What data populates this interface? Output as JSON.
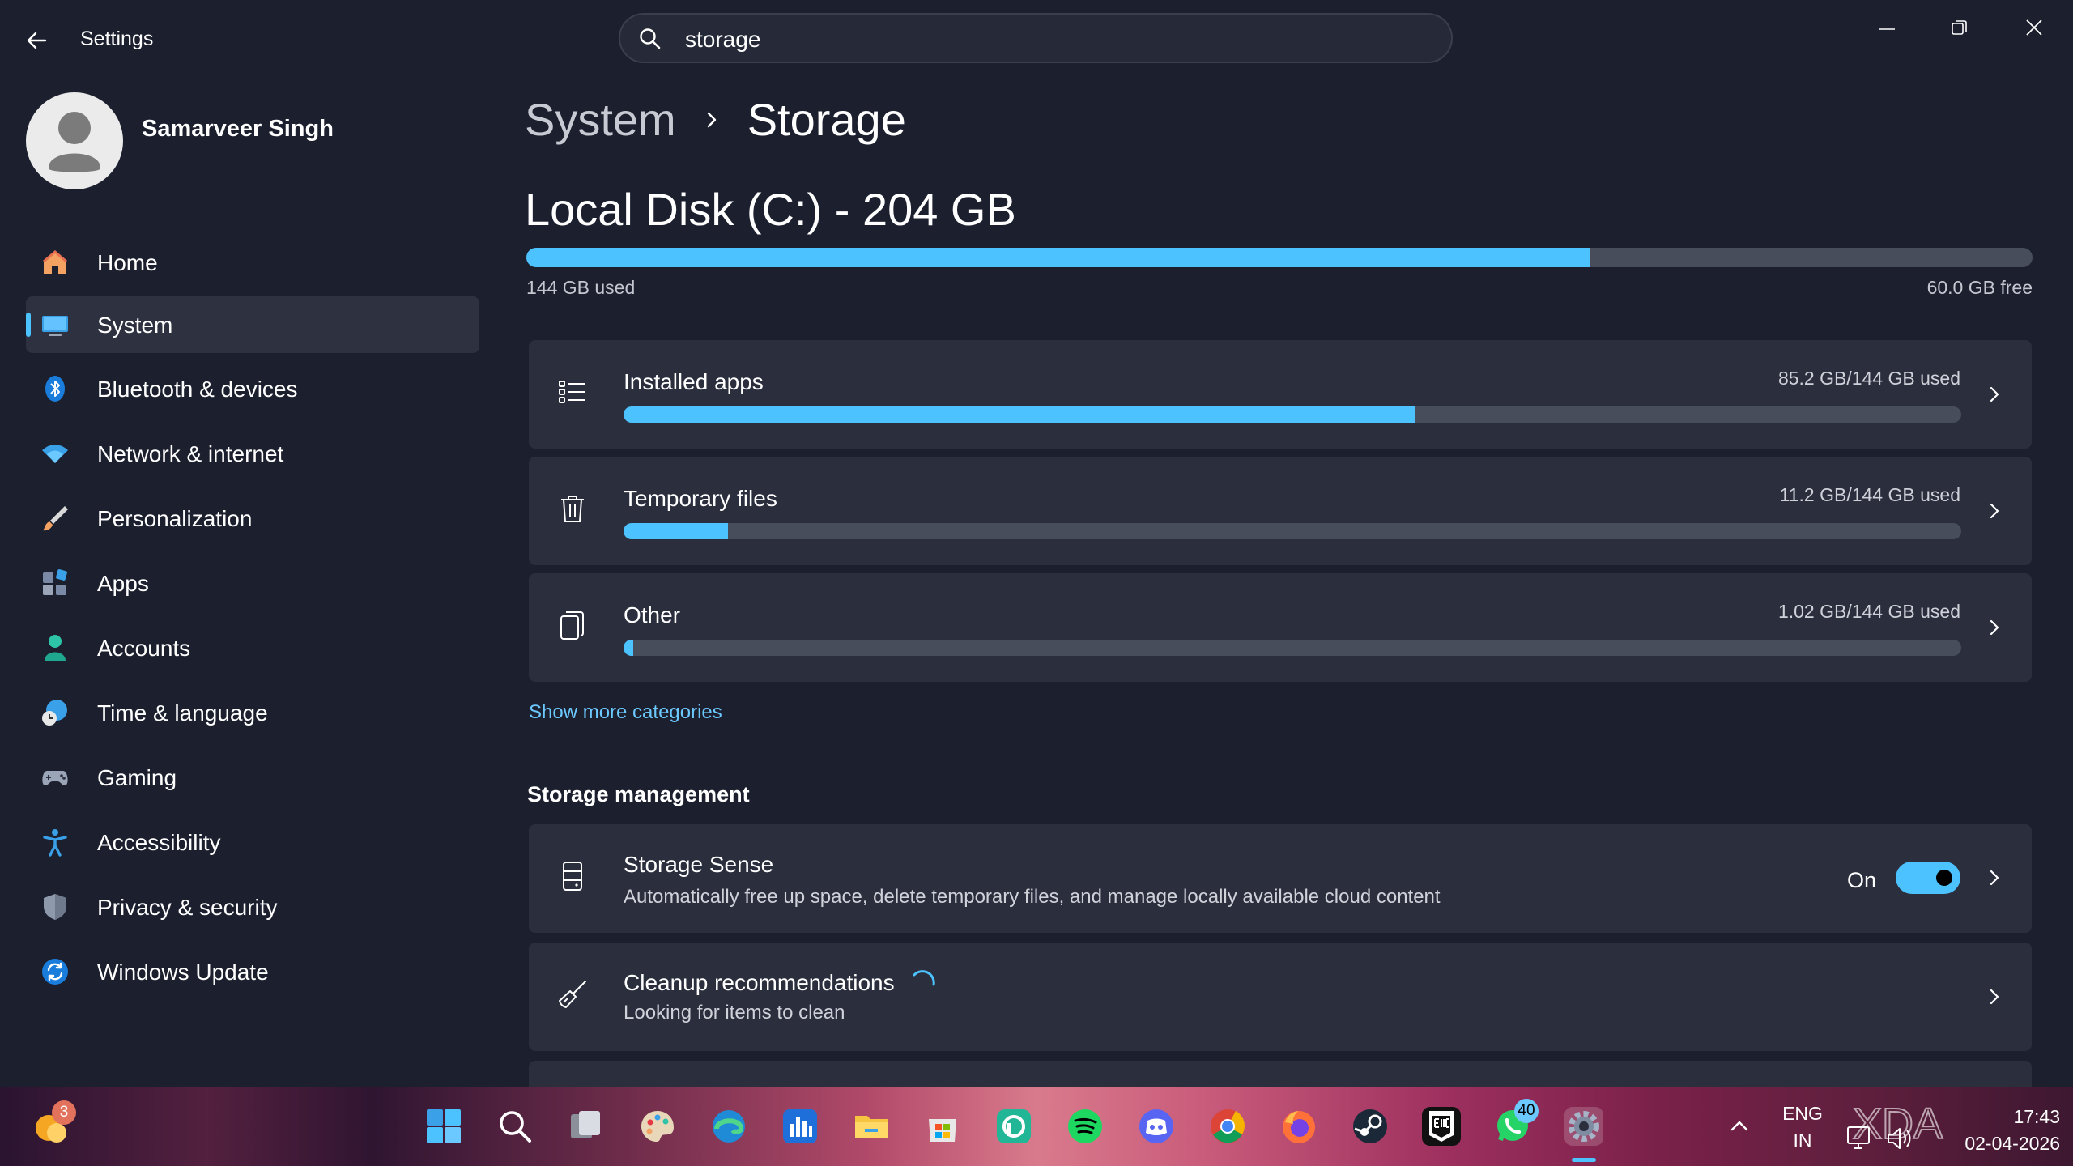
{
  "window": {
    "title": "Settings",
    "search_value": "storage",
    "controls": [
      "minimize-icon",
      "maximize-icon",
      "close-icon"
    ]
  },
  "user": {
    "name": "Samarveer Singh"
  },
  "sidebar": {
    "items": [
      {
        "label": "Home",
        "icon": "home-icon"
      },
      {
        "label": "System",
        "icon": "system-icon",
        "selected": true
      },
      {
        "label": "Bluetooth & devices",
        "icon": "bluetooth-icon"
      },
      {
        "label": "Network & internet",
        "icon": "wifi-icon"
      },
      {
        "label": "Personalization",
        "icon": "brush-icon"
      },
      {
        "label": "Apps",
        "icon": "apps-icon"
      },
      {
        "label": "Accounts",
        "icon": "account-icon"
      },
      {
        "label": "Time & language",
        "icon": "globe-clock-icon"
      },
      {
        "label": "Gaming",
        "icon": "gamepad-icon"
      },
      {
        "label": "Accessibility",
        "icon": "accessibility-icon"
      },
      {
        "label": "Privacy & security",
        "icon": "shield-icon"
      },
      {
        "label": "Windows Update",
        "icon": "update-icon"
      }
    ]
  },
  "breadcrumb": {
    "parent": "System",
    "separator": ">",
    "current": "Storage"
  },
  "disk": {
    "title": "Local Disk (C:) - 204 GB",
    "used_label": "144 GB used",
    "free_label": "60.0 GB free",
    "used_fraction": 0.706
  },
  "categories": [
    {
      "label": "Installed apps",
      "usage": "85.2 GB/144 GB used",
      "fraction": 0.592,
      "icon": "list-icon"
    },
    {
      "label": "Temporary files",
      "usage": "11.2 GB/144 GB used",
      "fraction": 0.078,
      "icon": "trash-icon"
    },
    {
      "label": "Other",
      "usage": "1.02 GB/144 GB used",
      "fraction": 0.007,
      "icon": "file-icon"
    }
  ],
  "show_more": "Show more categories",
  "storage_management": {
    "heading": "Storage management",
    "storage_sense": {
      "title": "Storage Sense",
      "description": "Automatically free up space, delete temporary files, and manage locally available cloud content",
      "toggle_label": "On",
      "enabled": true
    },
    "cleanup": {
      "title": "Cleanup recommendations",
      "description": "Looking for items to clean"
    }
  },
  "taskbar": {
    "weather_badge": "3",
    "whatsapp_badge": "40",
    "language_top": "ENG",
    "language_bottom": "IN",
    "time": "17:43",
    "date": "02-04-2026",
    "watermark": "XDA",
    "accent": "#4cc2ff"
  }
}
